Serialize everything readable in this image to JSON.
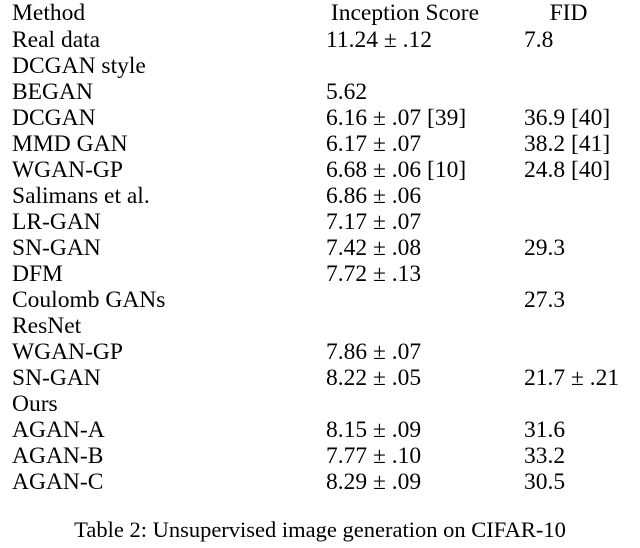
{
  "table": {
    "columns": [
      "Method",
      "Inception Score",
      "FID"
    ],
    "rows": [
      {
        "kind": "data",
        "method": "Real data",
        "is": "11.24 ± .12",
        "fid": "7.8",
        "rule_above": "thin",
        "is_bold": false,
        "fid_bold": false
      },
      {
        "kind": "group",
        "method": "DCGAN style",
        "is": "",
        "fid": "",
        "rule_above": "mid",
        "is_bold": false,
        "fid_bold": false
      },
      {
        "kind": "data",
        "method": "BEGAN",
        "is": "5.62",
        "fid": "",
        "rule_above": "none",
        "is_bold": false,
        "fid_bold": false
      },
      {
        "kind": "data",
        "method": "DCGAN",
        "is": "6.16 ± .07 [39]",
        "fid": "36.9 [40]",
        "rule_above": "none",
        "is_bold": false,
        "fid_bold": false
      },
      {
        "kind": "data",
        "method": "MMD GAN",
        "is": "6.17 ± .07",
        "fid": "38.2 [41]",
        "rule_above": "none",
        "is_bold": false,
        "fid_bold": false
      },
      {
        "kind": "data",
        "method": "WGAN-GP",
        "is": "6.68 ± .06 [10]",
        "fid": "24.8 [40]",
        "rule_above": "none",
        "is_bold": false,
        "fid_bold": false
      },
      {
        "kind": "data",
        "method": "Salimans et al.",
        "is": "6.86 ± .06",
        "fid": "",
        "rule_above": "none",
        "is_bold": false,
        "fid_bold": false
      },
      {
        "kind": "data",
        "method": "LR-GAN",
        "is": "7.17 ± .07",
        "fid": "",
        "rule_above": "none",
        "is_bold": false,
        "fid_bold": false
      },
      {
        "kind": "data",
        "method": "SN-GAN",
        "is": "7.42 ± .08",
        "fid": "29.3",
        "rule_above": "none",
        "is_bold": false,
        "fid_bold": false
      },
      {
        "kind": "data",
        "method": "DFM",
        "is": "7.72 ± .13",
        "fid": "",
        "rule_above": "none",
        "is_bold": false,
        "fid_bold": false
      },
      {
        "kind": "data",
        "method": "Coulomb GANs",
        "is": "",
        "fid": "27.3",
        "rule_above": "none",
        "is_bold": false,
        "fid_bold": false
      },
      {
        "kind": "group",
        "method": "ResNet",
        "is": "",
        "fid": "",
        "rule_above": "mid",
        "is_bold": false,
        "fid_bold": false
      },
      {
        "kind": "data",
        "method": "WGAN-GP",
        "is": "7.86 ± .07",
        "fid": "",
        "rule_above": "none",
        "is_bold": false,
        "fid_bold": false
      },
      {
        "kind": "data",
        "method": "SN-GAN",
        "is": "8.22 ± .05",
        "fid": "21.7 ± .21",
        "rule_above": "none",
        "is_bold": false,
        "fid_bold": true
      },
      {
        "kind": "group",
        "method": "Ours",
        "is": "",
        "fid": "",
        "rule_above": "mid",
        "is_bold": false,
        "fid_bold": false
      },
      {
        "kind": "data",
        "method": "AGAN-A",
        "is": "8.15 ± .09",
        "fid": "31.6",
        "rule_above": "none",
        "is_bold": false,
        "fid_bold": false
      },
      {
        "kind": "data",
        "method": "AGAN-B",
        "is": "7.77 ± .10",
        "fid": "33.2",
        "rule_above": "none",
        "is_bold": false,
        "fid_bold": false
      },
      {
        "kind": "data",
        "method": "AGAN-C",
        "is": "8.29 ± .09",
        "fid": "30.5",
        "rule_above": "none",
        "is_bold": true,
        "fid_bold": false
      }
    ]
  },
  "caption": "Table 2: Unsupervised image generation on CIFAR-10"
}
